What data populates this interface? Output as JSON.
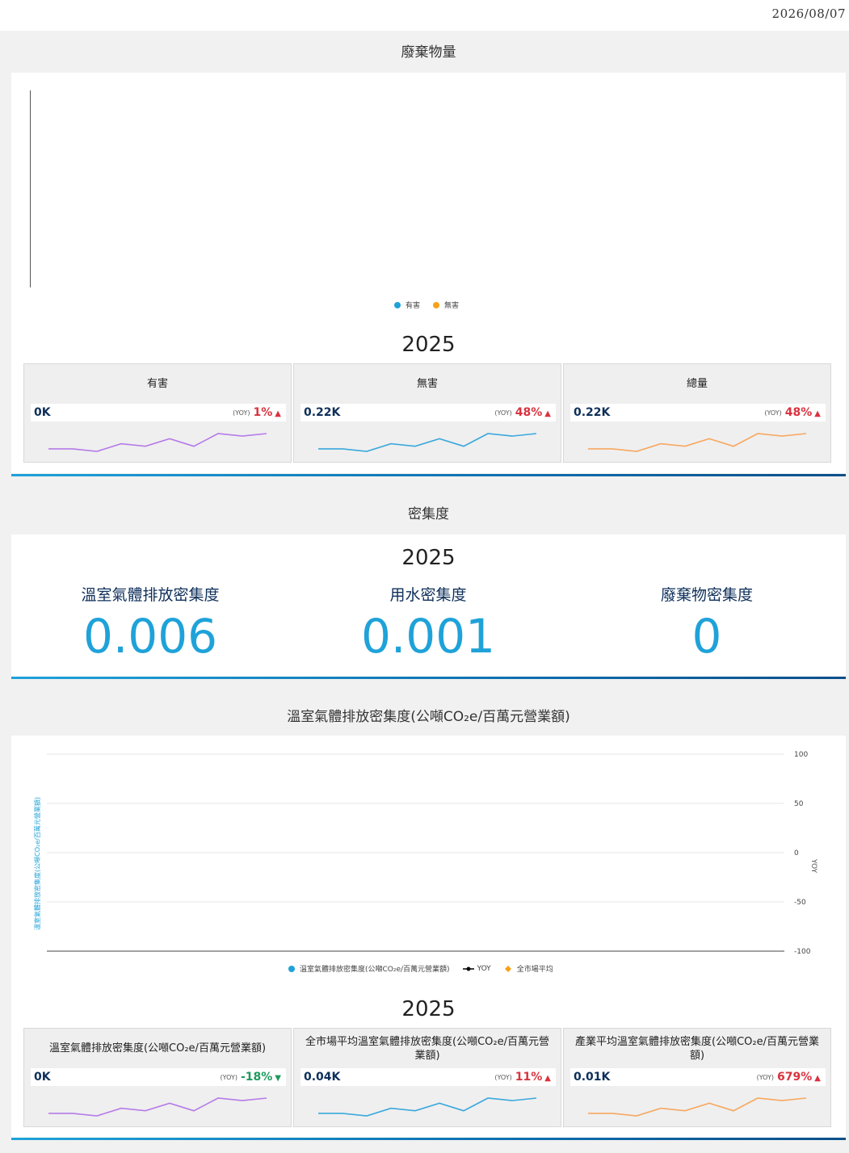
{
  "date": "2026/08/07",
  "waste": {
    "title": "廢棄物量",
    "legend": [
      {
        "label": "有害",
        "color": "#1fa2d9"
      },
      {
        "label": "無害",
        "color": "#f7a11a"
      }
    ],
    "year": "2025",
    "kpis": [
      {
        "title": "有害",
        "value": "0K",
        "yoy_label": "(YOY)",
        "yoy": "1%",
        "direction": "up",
        "color": "#b57be8",
        "spark": [
          3,
          3,
          2,
          5,
          4,
          7,
          4,
          9,
          8,
          9
        ]
      },
      {
        "title": "無害",
        "value": "0.22K",
        "yoy_label": "(YOY)",
        "yoy": "48%",
        "direction": "up",
        "color": "#3aa8dd",
        "spark": [
          3,
          3,
          2,
          5,
          4,
          7,
          4,
          9,
          8,
          9
        ]
      },
      {
        "title": "總量",
        "value": "0.22K",
        "yoy_label": "(YOY)",
        "yoy": "48%",
        "direction": "up",
        "color": "#f7a860",
        "spark": [
          3,
          3,
          2,
          5,
          4,
          7,
          4,
          9,
          8,
          9
        ]
      }
    ]
  },
  "intensity": {
    "title": "密集度",
    "year": "2025",
    "items": [
      {
        "label": "溫室氣體排放密集度",
        "value": "0.006"
      },
      {
        "label": "用水密集度",
        "value": "0.001"
      },
      {
        "label": "廢棄物密集度",
        "value": "0"
      }
    ]
  },
  "ghg": {
    "title": "溫室氣體排放密集度(公噸CO₂e/百萬元營業額)",
    "y_left_label": "溫室氣體排放密集度(公噸CO₂e/百萬元營業額)",
    "y_right_label": "YOY",
    "legend": [
      {
        "label": "溫室氣體排放密集度(公噸CO₂e/百萬元營業額)",
        "color": "#1fa2d9",
        "marker": "dot"
      },
      {
        "label": "YOY",
        "color": "#000000",
        "marker": "line"
      },
      {
        "label": "全市場平均",
        "color": "#f7a11a",
        "marker": "diamond"
      }
    ],
    "year": "2025",
    "kpis": [
      {
        "title": "溫室氣體排放密集度(公噸CO₂e/百萬元營業額)",
        "value": "0K",
        "yoy_label": "(YOY)",
        "yoy": "-18%",
        "direction": "down",
        "color": "#b57be8",
        "spark": [
          3,
          3,
          2,
          5,
          4,
          7,
          4,
          9,
          8,
          9
        ]
      },
      {
        "title": "全市場平均溫室氣體排放密集度(公噸CO₂e/百萬元營業額)",
        "value": "0.04K",
        "yoy_label": "(YOY)",
        "yoy": "11%",
        "direction": "up",
        "color": "#3aa8dd",
        "spark": [
          3,
          3,
          2,
          5,
          4,
          7,
          4,
          9,
          8,
          9
        ]
      },
      {
        "title": "產業平均溫室氣體排放密集度(公噸CO₂e/百萬元營業額)",
        "value": "0.01K",
        "yoy_label": "(YOY)",
        "yoy": "679%",
        "direction": "up",
        "color": "#f7a860",
        "spark": [
          3,
          3,
          2,
          5,
          4,
          7,
          4,
          9,
          8,
          9
        ]
      }
    ]
  },
  "chart_data": {
    "type": "line",
    "title": "溫室氣體排放密集度(公噸CO₂e/百萬元營業額)",
    "ylabel": "溫室氣體排放密集度(公噸CO₂e/百萬元營業額)",
    "y2label": "YOY",
    "y2_ticks": [
      "100",
      "50",
      "0",
      "-50",
      "-100"
    ],
    "y2lim": [
      -100,
      100
    ],
    "series": [
      {
        "name": "溫室氣體排放密集度(公噸CO₂e/百萬元營業額)",
        "values": []
      },
      {
        "name": "YOY",
        "values": []
      },
      {
        "name": "全市場平均",
        "values": []
      }
    ],
    "grid": true,
    "legend": "bottom"
  }
}
